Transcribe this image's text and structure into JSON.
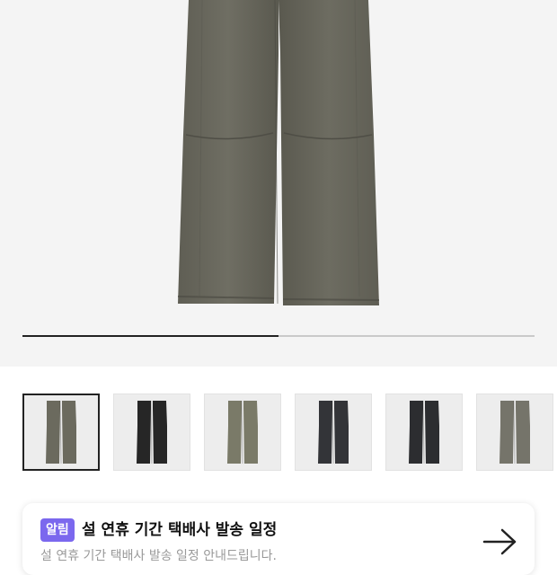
{
  "product": {
    "image_icon": "wide-leg-cargo-pants",
    "gallery_progress": 0.5,
    "thumbnails": [
      {
        "icon": "pants-olive-gray",
        "color": "#6b6a5e",
        "selected": true
      },
      {
        "icon": "pants-black",
        "color": "#262626",
        "selected": false
      },
      {
        "icon": "pants-khaki",
        "color": "#7a7a68",
        "selected": false
      },
      {
        "icon": "pants-charcoal",
        "color": "#333438",
        "selected": false
      },
      {
        "icon": "pants-dark-gray",
        "color": "#2c2d30",
        "selected": false
      },
      {
        "icon": "pants-gray",
        "color": "#75746a",
        "selected": false
      }
    ]
  },
  "notice": {
    "badge": "알림",
    "title": "설 연휴 기간 택배사 발송 일정",
    "subtitle": "설 연휴 기간 택배사 발송 일정 안내드립니다.",
    "arrow_icon": "arrow-right-icon",
    "badge_color": "#7b68ee"
  }
}
